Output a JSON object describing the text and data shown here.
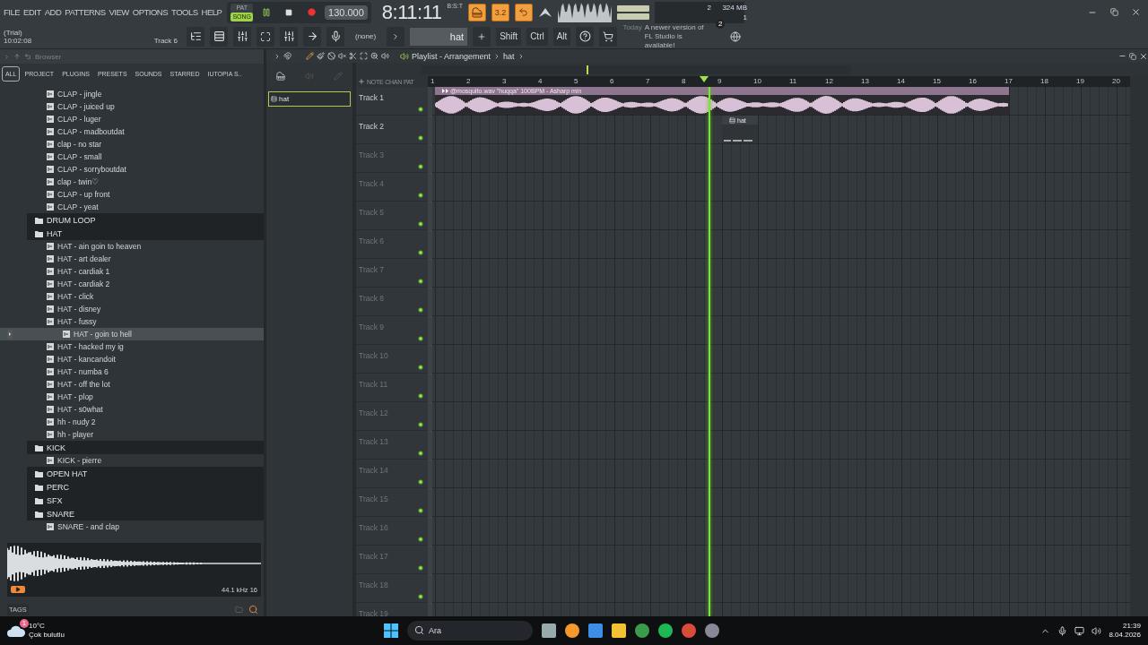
{
  "menu": [
    "FILE",
    "EDIT",
    "ADD",
    "PATTERNS",
    "VIEW",
    "OPTIONS",
    "TOOLS",
    "HELP"
  ],
  "hint": {
    "title": "(Trial)",
    "time": "10:02:08",
    "target": "Track 6"
  },
  "transport": {
    "modes": [
      {
        "label": "PAT",
        "selected": false
      },
      {
        "label": "SONG",
        "selected": true
      }
    ],
    "tempo": "130.000",
    "time": "8:11:11",
    "time_format": "B:S:T"
  },
  "toggles": [
    {
      "label": "3.2",
      "kind": "text"
    },
    {
      "kind": "icon"
    }
  ],
  "cpu": {
    "voices": "2",
    "memory": "324 MB",
    "polyphony": "1"
  },
  "toolbar": {
    "channel": "(none)",
    "pattern": "hat",
    "keys": [
      "Shift",
      "Ctrl",
      "Alt"
    ]
  },
  "news": {
    "label": "Today",
    "text": "A newer version of FL Studio is available!",
    "count": "2"
  },
  "browser": {
    "title": "Browser",
    "tabs": [
      {
        "label": "ALL",
        "selected": true
      },
      {
        "label": "PROJECT",
        "selected": false
      },
      {
        "label": "PLUGINS",
        "selected": false
      },
      {
        "label": "PRESETS",
        "selected": false
      },
      {
        "label": "SOUNDS",
        "selected": false
      },
      {
        "label": "STARRED",
        "selected": false
      },
      {
        "label": "IUTOPIA S..",
        "selected": false
      }
    ],
    "tree": [
      {
        "kind": "folder",
        "children": [
          {
            "kind": "file",
            "label": "CLAP - jingle",
            "selected": false
          },
          {
            "kind": "file",
            "label": "CLAP - juiced up",
            "selected": false
          },
          {
            "kind": "file",
            "label": "CLAP - luger",
            "selected": false
          },
          {
            "kind": "file",
            "label": "CLAP - madboutdat",
            "selected": false
          },
          {
            "kind": "file",
            "label": "clap - no star",
            "selected": false
          },
          {
            "kind": "file",
            "label": "CLAP - small",
            "selected": false
          },
          {
            "kind": "file",
            "label": "CLAP - sorryboutdat",
            "selected": false
          },
          {
            "kind": "file",
            "label": "clap - twin♡",
            "selected": false
          },
          {
            "kind": "file",
            "label": "CLAP - up front",
            "selected": false
          },
          {
            "kind": "file",
            "label": "CLAP - yeat",
            "selected": false
          }
        ]
      },
      {
        "kind": "folder",
        "label": "DRUM LOOP"
      },
      {
        "kind": "folder",
        "label": "HAT",
        "children": [
          {
            "kind": "file",
            "label": "HAT - ain goin to heaven",
            "selected": false
          },
          {
            "kind": "file",
            "label": "HAT - art dealer",
            "selected": false
          },
          {
            "kind": "file",
            "label": "HAT - cardiak 1",
            "selected": false
          },
          {
            "kind": "file",
            "label": "HAT - cardiak 2",
            "selected": false
          },
          {
            "kind": "file",
            "label": "HAT - click",
            "selected": false
          },
          {
            "kind": "file",
            "label": "HAT - disney",
            "selected": false
          },
          {
            "kind": "file",
            "label": "HAT - fussy",
            "selected": false
          },
          {
            "kind": "file",
            "label": "HAT - goin to hell",
            "selected": true
          },
          {
            "kind": "file",
            "label": "HAT - hacked my ig",
            "selected": false
          },
          {
            "kind": "file",
            "label": "HAT - kancandoit",
            "selected": false
          },
          {
            "kind": "file",
            "label": "HAT - numba 6",
            "selected": false
          },
          {
            "kind": "file",
            "label": "HAT - off the lot",
            "selected": false
          },
          {
            "kind": "file",
            "label": "HAT - plop",
            "selected": false
          },
          {
            "kind": "file",
            "label": "HAT - s0what",
            "selected": false
          },
          {
            "kind": "file",
            "label": "hh - nudy 2",
            "selected": false
          },
          {
            "kind": "file",
            "label": "hh - player",
            "selected": false
          }
        ]
      },
      {
        "kind": "folder",
        "label": "KICK",
        "children": [
          {
            "kind": "file",
            "label": "KICK - pierre",
            "selected": false
          }
        ]
      },
      {
        "kind": "folder",
        "label": "OPEN HAT"
      },
      {
        "kind": "folder",
        "label": "PERC"
      },
      {
        "kind": "folder",
        "label": "SFX"
      },
      {
        "kind": "folder",
        "label": "SNARE",
        "children": [
          {
            "kind": "file",
            "label": "SNARE - and clap",
            "selected": false
          }
        ]
      }
    ],
    "preview": {
      "info": "44.1 kHz 16"
    },
    "tags": "TAGS"
  },
  "playlist": {
    "title": "Playlist - Arrangement",
    "pattern": "hat",
    "picker": [
      {
        "label": "hat",
        "selected": true
      }
    ],
    "picker_modes": [
      "NOTE",
      "CHAN",
      "PAT"
    ],
    "ruler": [
      "1",
      "2",
      "3",
      "4",
      "5",
      "6",
      "7",
      "8",
      "9",
      "10",
      "11",
      "12",
      "13",
      "14",
      "15",
      "16",
      "17",
      "18",
      "19",
      "20"
    ],
    "tracks": [
      {
        "name": "Track 1",
        "clips": [
          {
            "kind": "audio",
            "label": "@mosquito.wav \"huqqa\" 100BPM - Asharp min"
          }
        ]
      },
      {
        "name": "Track 2",
        "clips": [
          {
            "kind": "pattern",
            "label": "hat"
          }
        ]
      },
      {
        "name": "Track 3"
      },
      {
        "name": "Track 4"
      },
      {
        "name": "Track 5"
      },
      {
        "name": "Track 6"
      },
      {
        "name": "Track 7"
      },
      {
        "name": "Track 8"
      },
      {
        "name": "Track 9"
      },
      {
        "name": "Track 10"
      },
      {
        "name": "Track 11"
      },
      {
        "name": "Track 12"
      },
      {
        "name": "Track 13"
      },
      {
        "name": "Track 14"
      },
      {
        "name": "Track 15"
      },
      {
        "name": "Track 16"
      },
      {
        "name": "Track 17"
      },
      {
        "name": "Track 18"
      },
      {
        "name": "Track 19"
      }
    ]
  },
  "taskbar": {
    "weather": {
      "badge": "1",
      "temp": "10°C",
      "text": "Çok bulutlu"
    },
    "search": {
      "placeholder": "Ara"
    },
    "clock": {
      "time": "21:39",
      "date": "8.04.2026"
    }
  }
}
